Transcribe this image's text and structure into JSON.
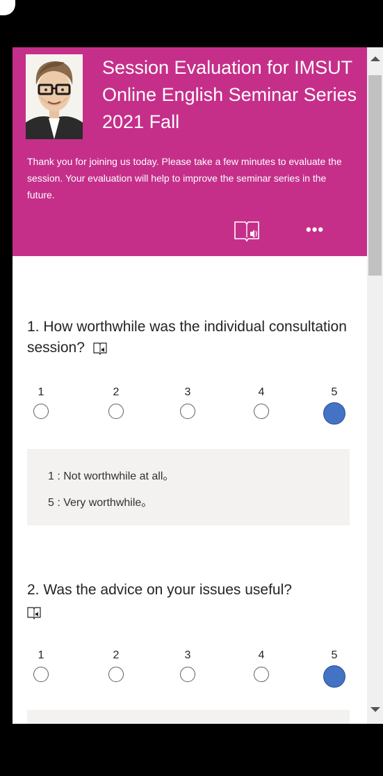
{
  "header": {
    "title": "Session Evaluation for IMSUT Online English Seminar Series 2021 Fall",
    "description": "Thank you for joining us today. Please take a few minutes to evaluate the session. Your evaluation will help to improve the seminar series in the future.",
    "reader_icon": "immersive-reader-icon",
    "more_label": "•••",
    "color": "#c52f8a"
  },
  "questions": [
    {
      "text": "1. How worthwhile was the individual consultation session?",
      "options": [
        "1",
        "2",
        "3",
        "4",
        "5"
      ],
      "selected": "5",
      "legend": [
        "1 : Not worthwhile at all。",
        "5 : Very worthwhile。"
      ]
    },
    {
      "text": "2. Was the advice on your issues useful?",
      "options": [
        "1",
        "2",
        "3",
        "4",
        "5"
      ],
      "selected": "5"
    }
  ],
  "colors": {
    "selected_radio": "#4472c4",
    "legend_bg": "#f3f2f1"
  }
}
